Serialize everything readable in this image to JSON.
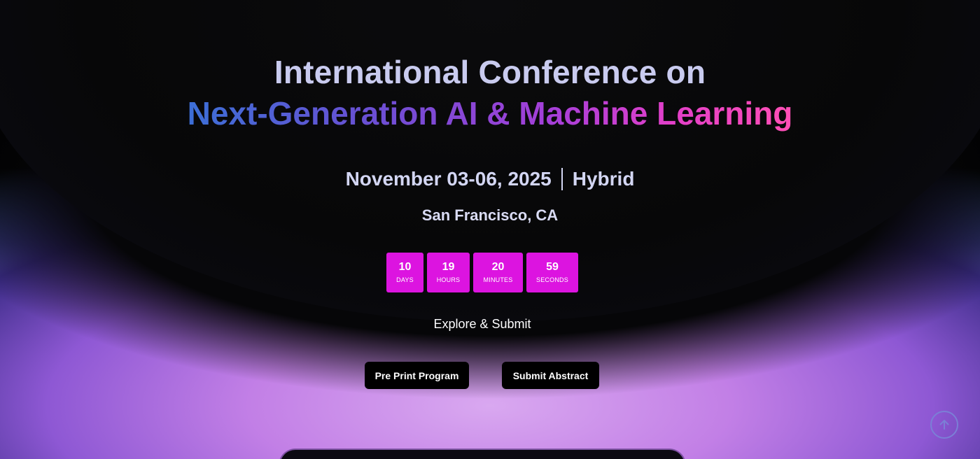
{
  "title": {
    "line1": "International Conference on",
    "line2": "Next-Generation AI & Machine Learning"
  },
  "event": {
    "dates": "November 03-06, 2025",
    "mode": "Hybrid",
    "location": "San Francisco, CA"
  },
  "countdown": [
    {
      "value": "10",
      "label": "DAYS"
    },
    {
      "value": "19",
      "label": "HOURS"
    },
    {
      "value": "20",
      "label": "MINUTES"
    },
    {
      "value": "59",
      "label": "SECONDS"
    }
  ],
  "cta": {
    "heading": "Explore & Submit",
    "preprint_label": "Pre Print Program",
    "submit_label": "Submit Abstract"
  },
  "icons": {
    "scroll_top": "arrow-up-icon"
  },
  "colors": {
    "countdown_bg": "#dc14e0",
    "gradient_start": "#3c6fd6",
    "gradient_end": "#ff4fb5"
  }
}
